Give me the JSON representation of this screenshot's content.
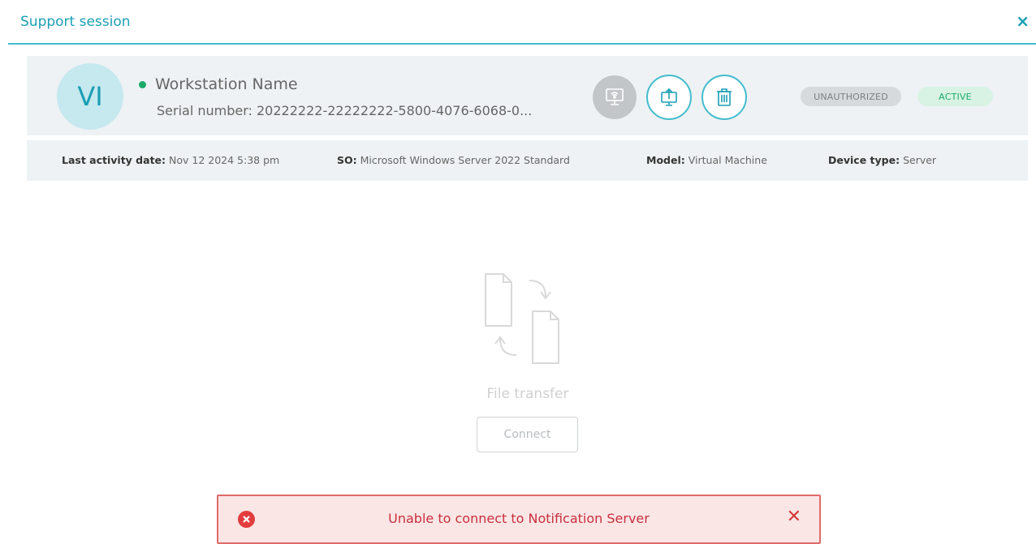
{
  "header": {
    "title": "Support session",
    "close_icon": "close-icon"
  },
  "device": {
    "avatar_initials": "VI",
    "status": "online",
    "name": "Workstation Name",
    "serial": "Serial number: 20222222-22222222-5800-4076-6068-0...",
    "badges": {
      "unauthorized": "UNAUTHORIZED",
      "active": "ACTIVE"
    }
  },
  "info": {
    "last_activity_label": "Last activity date:",
    "last_activity_value": "Nov 12 2024 5:38 pm",
    "os_label": "SO:",
    "os_value": "Microsoft Windows Server 2022 Standard",
    "model_label": "Model:",
    "model_value": "Virtual Machine",
    "device_type_label": "Device type:",
    "device_type_value": "Server"
  },
  "main": {
    "transfer_label": "File transfer",
    "connect_label": "Connect"
  },
  "toast": {
    "message": "Unable to connect to Notification Server",
    "close_symbol": "✕"
  },
  "colors": {
    "accent": "#1a9fb4",
    "status_green": "#1aaa6a",
    "error_red": "#e23d3d",
    "panel_bg": "#eef2f4"
  }
}
